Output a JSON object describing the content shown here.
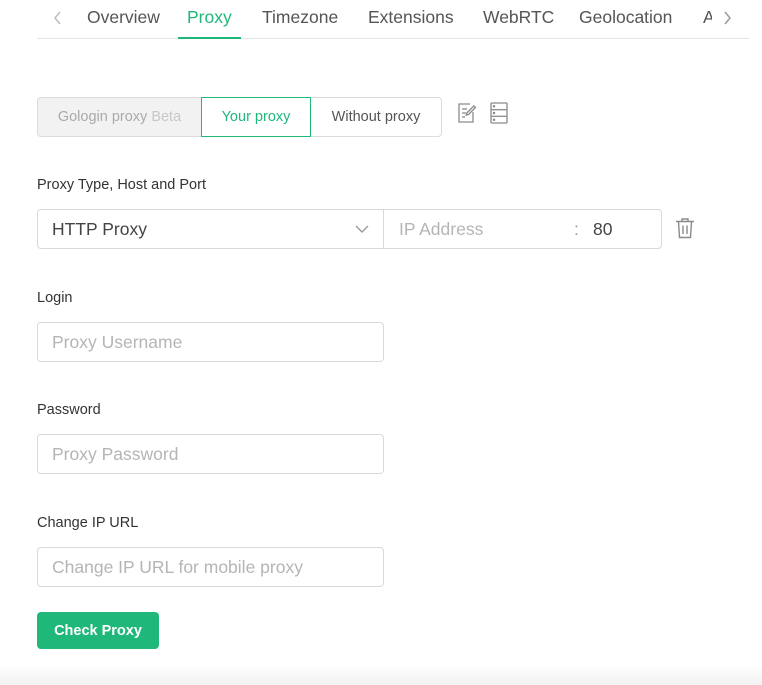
{
  "tabs": [
    {
      "label": "Overview",
      "active": false
    },
    {
      "label": "Proxy",
      "active": true
    },
    {
      "label": "Timezone",
      "active": false
    },
    {
      "label": "Extensions",
      "active": false
    },
    {
      "label": "WebRTC",
      "active": false
    },
    {
      "label": "Geolocation",
      "active": false
    },
    {
      "label": "A",
      "active": false
    }
  ],
  "proxy_mode": {
    "options": [
      {
        "label": "Gologin proxy",
        "badge": "Beta",
        "state": "disabled"
      },
      {
        "label": "Your proxy",
        "state": "selected"
      },
      {
        "label": "Without proxy",
        "state": "normal"
      }
    ],
    "icons": [
      "edit-list-icon",
      "server-icon"
    ]
  },
  "proxy_type": {
    "label": "Proxy Type, Host and Port",
    "selected_type": "HTTP Proxy",
    "host_placeholder": "IP Address",
    "host_value": "",
    "separator": ":",
    "port_value": "80",
    "delete_icon": "trash-icon"
  },
  "login": {
    "label": "Login",
    "placeholder": "Proxy Username",
    "value": ""
  },
  "password": {
    "label": "Password",
    "placeholder": "Proxy Password",
    "value": ""
  },
  "change_ip": {
    "label": "Change IP URL",
    "placeholder": "Change IP URL for mobile proxy",
    "value": ""
  },
  "check_button": {
    "label": "Check Proxy"
  },
  "colors": {
    "accent": "#1fb87a",
    "border": "#d9d9d9",
    "muted": "#aaaaaa"
  }
}
